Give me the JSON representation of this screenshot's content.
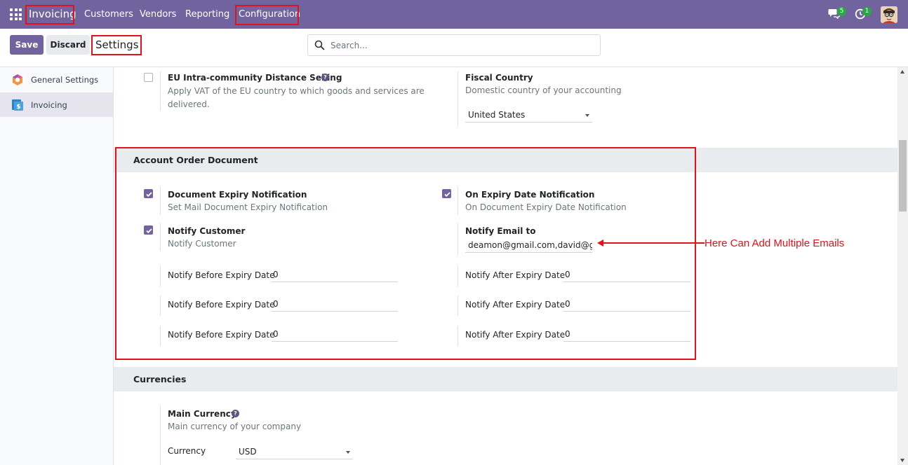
{
  "navbar": {
    "app_name": "Invoicing",
    "menu": [
      "Customers",
      "Vendors",
      "Reporting",
      "Configuration"
    ],
    "messages_count": "5",
    "activities_count": "1",
    "accent_color": "#71639e"
  },
  "control_panel": {
    "save_label": "Save",
    "discard_label": "Discard",
    "title": "Settings",
    "search_placeholder": "Search..."
  },
  "sidebar": {
    "items": [
      {
        "label": "General Settings",
        "icon": "odoo-settings-icon",
        "active": false
      },
      {
        "label": "Invoicing",
        "icon": "invoicing-app-icon",
        "active": true
      }
    ]
  },
  "top_settings": {
    "eu_selling": {
      "label": "EU Intra-community Distance Selling",
      "description": "Apply VAT of the EU country to which goods and services are delivered.",
      "checked": false
    },
    "fiscal_country": {
      "label": "Fiscal Country",
      "description": "Domestic country of your accounting",
      "value": "United States"
    }
  },
  "account_order_document": {
    "title": "Account Order Document",
    "expiry_notification": {
      "label": "Document Expiry Notification",
      "description": "Set Mail Document Expiry Notification",
      "checked": true
    },
    "expiry_date_notification": {
      "label": "On Expiry Date Notification",
      "description": "On Document Expiry Date Notification",
      "checked": true
    },
    "notify_customer": {
      "label": "Notify Customer",
      "description": "Notify Customer",
      "checked": true
    },
    "notify_email": {
      "label": "Notify Email to",
      "value": "deamon@gmail.com,david@gr"
    },
    "before_rows": [
      {
        "label": "Notify Before Expiry Date",
        "value": "0"
      },
      {
        "label": "Notify Before Expiry Date",
        "value": "0"
      },
      {
        "label": "Notify Before Expiry Date",
        "value": "0"
      }
    ],
    "after_rows": [
      {
        "label": "Notify After Expiry Date",
        "value": "0"
      },
      {
        "label": "Notify After Expiry Date",
        "value": "0"
      },
      {
        "label": "Notify After Expiry Date",
        "value": "0"
      }
    ]
  },
  "currencies": {
    "title": "Currencies",
    "main_currency": {
      "label": "Main Currency",
      "description": "Main currency of your company"
    },
    "currency": {
      "label": "Currency",
      "value": "USD"
    }
  },
  "annotation": {
    "text": "Here Can Add Multiple Emails",
    "color": "#e2121b"
  }
}
